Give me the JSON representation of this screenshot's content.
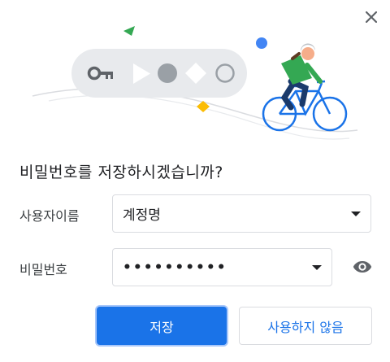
{
  "dialog": {
    "title": "비밀번호를 저장하시겠습니까?",
    "close_icon": "close-icon"
  },
  "username": {
    "label": "사용자이름",
    "value": "계정명"
  },
  "password": {
    "label": "비밀번호",
    "masked_value": "••••••••••",
    "reveal_icon": "eye-icon"
  },
  "buttons": {
    "save": "저장",
    "never": "사용하지 않음"
  },
  "colors": {
    "accent": "#1a73e8",
    "illustration_green": "#34a853",
    "illustration_blue": "#4285f4",
    "illustration_yellow": "#fbbc04"
  }
}
